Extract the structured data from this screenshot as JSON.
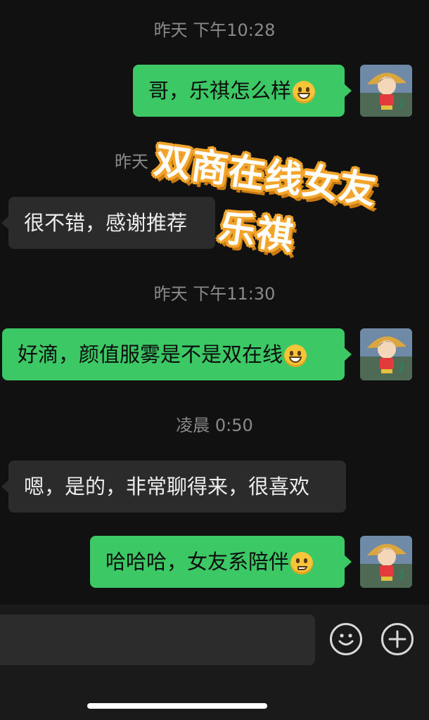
{
  "timestamps": [
    "昨天 下午10:28",
    "昨天",
    "昨天 下午11:30",
    "凌晨 0:50"
  ],
  "messages": [
    {
      "side": "out",
      "text": "哥，乐祺怎么样",
      "emoji": "grinning-teeth-emoji"
    },
    {
      "side": "in",
      "text": "很不错，感谢推荐"
    },
    {
      "side": "out",
      "text": "好滴，颜值服雾是不是双在线",
      "emoji": "grinning-face-emoji"
    },
    {
      "side": "in",
      "text": "嗯，是的，非常聊得来，很喜欢"
    },
    {
      "side": "out",
      "text": "哈哈哈，女友系陪伴",
      "emoji": "smirking-face-emoji"
    }
  ],
  "overlay": {
    "line1": "双商在线女友",
    "line2": "乐祺"
  },
  "input_bar": {
    "emoji_button_icon": "smiley-icon",
    "plus_button_icon": "plus-icon"
  },
  "colors": {
    "outgoing": "#3cc864",
    "incoming": "#2b2b2b",
    "background": "#111111",
    "overlay_stroke": "#f2a52a"
  }
}
